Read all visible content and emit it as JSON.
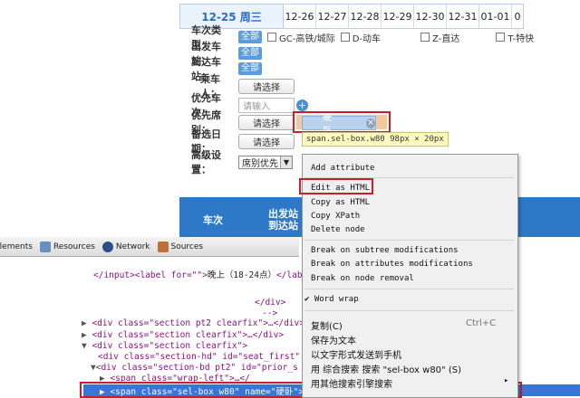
{
  "dates": [
    "12-25 周三",
    "12-26",
    "12-27",
    "12-28",
    "12-29",
    "12-30",
    "12-31",
    "01-01",
    "0"
  ],
  "form": {
    "train_type_label": "车次类型：",
    "all_label": "全部",
    "types": [
      "GC-高铁/城际",
      "D-动车",
      "Z-直达",
      "T-特快"
    ],
    "from_label": "出发车站：",
    "to_label": "到达车站：",
    "passenger_label": "乘车人：",
    "select_label": "请选择",
    "pref_train_label": "优先车次：",
    "input_placeholder": "请输入",
    "pref_seat_label": "优先席别：",
    "chip_text": "硬卧",
    "alt_date_label": "备选日期：",
    "advanced_label": "高级设置：",
    "dropdown_value": "席别优先",
    "tooltip": "span.sel-box.w80 98px × 20px"
  },
  "blue_bar": {
    "col1": "车次",
    "col2_line1": "出发站",
    "col2_line2": "到达站"
  },
  "devtools": {
    "tabs": [
      "Elements",
      "Resources",
      "Network",
      "Sources"
    ],
    "lines": {
      "l1_a": "</input>",
      "l1_b": "<label for=\"\">",
      "l1_c": "晚上（18-24点）",
      "l1_d": "</lab",
      "l2": "</div>",
      "l3": "-->",
      "l4_a": "<div class=\"section pt2 clearfix\">",
      "l4_b": "…</div>",
      "l5_a": "<div class=\"section clearfix\">",
      "l5_b": "…</div>",
      "l6": "<div class=\"section clearfix\">",
      "l7": "<div class=\"section-hd\" id=\"seat_first\"",
      "l8": "<div class=\"section-bd pt2\" id=\"prior_s",
      "l9_a": "<span class=\"wrap-left\">",
      "l9_b": "…</",
      "l10": "<span class=\"sel-box w80\" name=\"硬卧\">…</span>"
    }
  },
  "context_menu": {
    "items": [
      "Add attribute",
      "Edit as HTML",
      "Copy as HTML",
      "Copy XPath",
      "Delete node",
      "Break on subtree modifications",
      "Break on attributes modifications",
      "Break on node removal",
      "Word wrap",
      "复制(C)",
      "保存为文本",
      "以文字形式发送到手机",
      "用 综合搜索 搜索 \"sel-box w80\" (S)",
      "用其他搜索引擎搜索"
    ],
    "shortcut": "Ctrl+C",
    "checkmark": "✔"
  },
  "colors": {
    "accent_blue": "#2d79c7",
    "highlight_red": "#c8202a",
    "selection_blue": "#3875d7"
  }
}
